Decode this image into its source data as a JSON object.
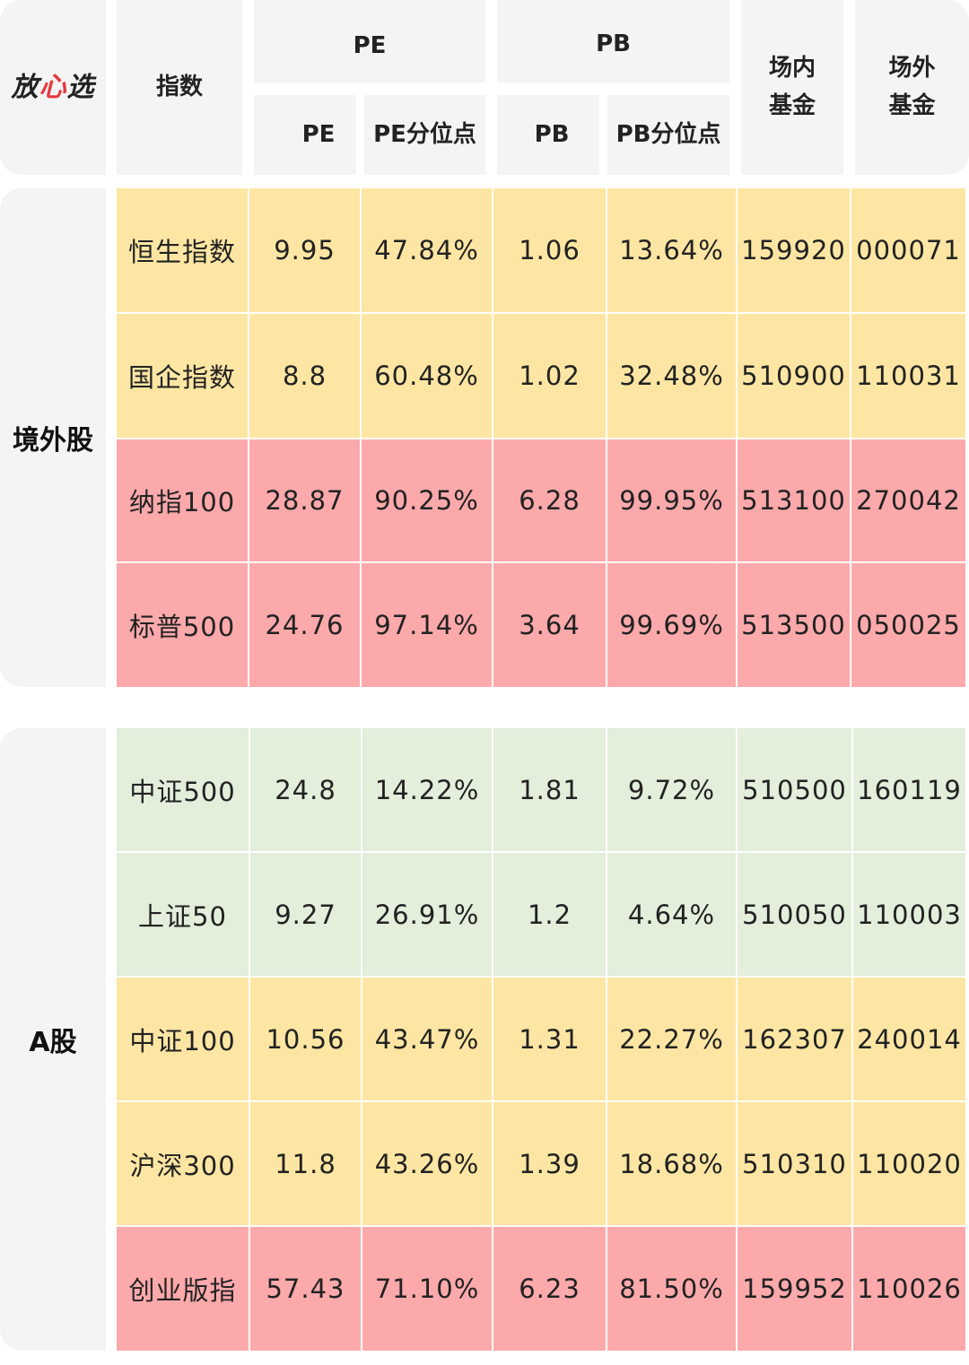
{
  "header": {
    "logo": {
      "pre": "放",
      "heart": "心",
      "post": "选"
    },
    "index_col": "指数",
    "pe_group": "PE",
    "pb_group": "PB",
    "pe": "PE",
    "pe_pct": "PE分位点",
    "pb": "PB",
    "pb_pct": "PB分位点",
    "onsite_fund": [
      "场内",
      "基金"
    ],
    "offsite_fund": [
      "场外",
      "基金"
    ]
  },
  "colors": {
    "yellow": "#fde6a3",
    "red": "#fca9ab",
    "green": "#e3eedb",
    "header_bg": "#f3f4f3",
    "logo_heart": "#e8383d"
  },
  "sections": [
    {
      "name": "境外股",
      "rows": [
        {
          "index": "恒生指数",
          "pe": "9.95",
          "pe_pct": "47.84%",
          "pb": "1.06",
          "pb_pct": "13.64%",
          "onsite": "159920",
          "offsite": "000071",
          "color": "yellow"
        },
        {
          "index": "国企指数",
          "pe": "8.8",
          "pe_pct": "60.48%",
          "pb": "1.02",
          "pb_pct": "32.48%",
          "onsite": "510900",
          "offsite": "110031",
          "color": "yellow"
        },
        {
          "index": "纳指100",
          "pe": "28.87",
          "pe_pct": "90.25%",
          "pb": "6.28",
          "pb_pct": "99.95%",
          "onsite": "513100",
          "offsite": "270042",
          "color": "red"
        },
        {
          "index": "标普500",
          "pe": "24.76",
          "pe_pct": "97.14%",
          "pb": "3.64",
          "pb_pct": "99.69%",
          "onsite": "513500",
          "offsite": "050025",
          "color": "red"
        }
      ]
    },
    {
      "name": "A股",
      "rows": [
        {
          "index": "中证500",
          "pe": "24.8",
          "pe_pct": "14.22%",
          "pb": "1.81",
          "pb_pct": "9.72%",
          "onsite": "510500",
          "offsite": "160119",
          "color": "green"
        },
        {
          "index": "上证50",
          "pe": "9.27",
          "pe_pct": "26.91%",
          "pb": "1.2",
          "pb_pct": "4.64%",
          "onsite": "510050",
          "offsite": "110003",
          "color": "green"
        },
        {
          "index": "中证100",
          "pe": "10.56",
          "pe_pct": "43.47%",
          "pb": "1.31",
          "pb_pct": "22.27%",
          "onsite": "162307",
          "offsite": "240014",
          "color": "yellow"
        },
        {
          "index": "沪深300",
          "pe": "11.8",
          "pe_pct": "43.26%",
          "pb": "1.39",
          "pb_pct": "18.68%",
          "onsite": "510310",
          "offsite": "110020",
          "color": "yellow"
        },
        {
          "index": "创业版指",
          "pe": "57.43",
          "pe_pct": "71.10%",
          "pb": "6.23",
          "pb_pct": "81.50%",
          "onsite": "159952",
          "offsite": "110026",
          "color": "red"
        }
      ]
    }
  ]
}
